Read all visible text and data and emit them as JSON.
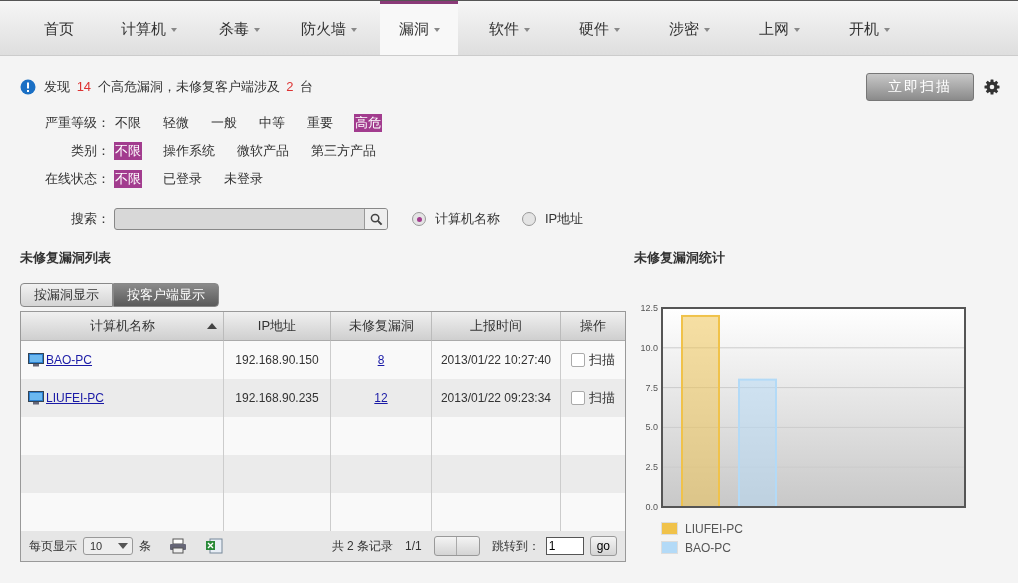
{
  "nav": [
    {
      "label": "首页",
      "menu": false,
      "selected": false
    },
    {
      "label": "计算机",
      "menu": true,
      "selected": false
    },
    {
      "label": "杀毒",
      "menu": true,
      "selected": false
    },
    {
      "label": "防火墙",
      "menu": true,
      "selected": false
    },
    {
      "label": "漏洞",
      "menu": true,
      "selected": true
    },
    {
      "label": "软件",
      "menu": true,
      "selected": false
    },
    {
      "label": "硬件",
      "menu": true,
      "selected": false
    },
    {
      "label": "涉密",
      "menu": true,
      "selected": false
    },
    {
      "label": "上网",
      "menu": true,
      "selected": false
    },
    {
      "label": "开机",
      "menu": true,
      "selected": false
    }
  ],
  "summary": {
    "prefix": "发现",
    "count": "14",
    "middle": "个高危漏洞，未修复客户端涉及",
    "clients": "2",
    "suffix": "台"
  },
  "scan_button": "立即扫描",
  "filters": [
    {
      "label": "严重等级：",
      "options": [
        {
          "label": "不限",
          "selected": false
        },
        {
          "label": "轻微",
          "selected": false
        },
        {
          "label": "一般",
          "selected": false
        },
        {
          "label": "中等",
          "selected": false
        },
        {
          "label": "重要",
          "selected": false
        },
        {
          "label": "高危",
          "selected": true
        }
      ]
    },
    {
      "label": "类别：",
      "options": [
        {
          "label": "不限",
          "selected": true
        },
        {
          "label": "操作系统",
          "selected": false
        },
        {
          "label": "微软产品",
          "selected": false
        },
        {
          "label": "第三方产品",
          "selected": false
        }
      ]
    },
    {
      "label": "在线状态：",
      "options": [
        {
          "label": "不限",
          "selected": true
        },
        {
          "label": "已登录",
          "selected": false
        },
        {
          "label": "未登录",
          "selected": false
        }
      ]
    }
  ],
  "search": {
    "label": "搜索："
  },
  "search_by": [
    {
      "label": "计算机名称",
      "selected": true
    },
    {
      "label": "IP地址",
      "selected": false
    }
  ],
  "list_title": "未修复漏洞列表",
  "view_tabs": [
    {
      "label": "按漏洞显示",
      "selected": false
    },
    {
      "label": "按客户端显示",
      "selected": true
    }
  ],
  "table": {
    "columns": [
      {
        "label": "计算机名称",
        "sorted": true
      },
      {
        "label": "IP地址",
        "sorted": false
      },
      {
        "label": "未修复漏洞",
        "sorted": false
      },
      {
        "label": "上报时间",
        "sorted": false
      },
      {
        "label": "操作",
        "sorted": false
      }
    ],
    "rows": [
      {
        "name": "BAO-PC",
        "ip": "192.168.90.150",
        "count": "8",
        "time": "2013/01/22 10:27:40",
        "checked": false,
        "action": "扫描"
      },
      {
        "name": "LIUFEI-PC",
        "ip": "192.168.90.235",
        "count": "12",
        "time": "2013/01/22 09:23:34",
        "checked": false,
        "action": "扫描"
      }
    ]
  },
  "footer": {
    "per_page_label": "每页显示",
    "per_page": "10",
    "per_page_unit": "条",
    "total": "共 2 条记录",
    "pages": "1/1",
    "jump_label": "跳转到：",
    "jump_value": "1",
    "go": "go"
  },
  "stats": {
    "title": "未修复漏洞统计",
    "chart_data": {
      "type": "bar",
      "grid": true,
      "legend": "bottom",
      "ylim": [
        0,
        12.5
      ],
      "yticks": [
        {
          "value": 0,
          "label": "0.0"
        },
        {
          "value": 2.5,
          "label": "2.5"
        },
        {
          "value": 5,
          "label": "5.0"
        },
        {
          "value": 7.5,
          "label": "7.5"
        },
        {
          "value": 10,
          "label": "10.0"
        },
        {
          "value": 12.5,
          "label": "12.5"
        }
      ],
      "series": [
        {
          "name": "LIUFEI-PC",
          "color": "#f0c24a",
          "values": [
            12
          ]
        },
        {
          "name": "BAO-PC",
          "color": "#b3daf7",
          "values": [
            8
          ]
        }
      ]
    }
  }
}
